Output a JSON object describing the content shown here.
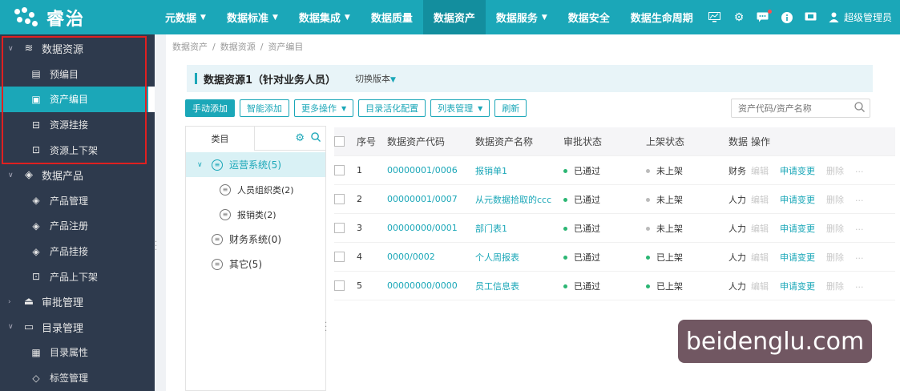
{
  "app": {
    "logo_text": "睿治"
  },
  "nav": [
    {
      "label": "元数据",
      "caret": true
    },
    {
      "label": "数据标准",
      "caret": true
    },
    {
      "label": "数据集成",
      "caret": true
    },
    {
      "label": "数据质量",
      "caret": false
    },
    {
      "label": "数据资产",
      "caret": false,
      "active": true
    },
    {
      "label": "数据服务",
      "caret": true
    },
    {
      "label": "数据安全",
      "caret": false
    },
    {
      "label": "数据生命周期",
      "caret": false
    }
  ],
  "user": {
    "name": "超级管理员"
  },
  "sidebar": {
    "groups": [
      {
        "label": "数据资源",
        "icon": "layers-icon",
        "expanded": true,
        "items": [
          {
            "label": "预编目",
            "icon": "list-icon"
          },
          {
            "label": "资产编目",
            "icon": "catalog-icon",
            "active": true
          },
          {
            "label": "资源挂接",
            "icon": "link-icon"
          },
          {
            "label": "资源上下架",
            "icon": "shelf-icon"
          }
        ]
      },
      {
        "label": "数据产品",
        "icon": "cube-icon",
        "expanded": true,
        "items": [
          {
            "label": "产品管理",
            "icon": "cube-gear-icon"
          },
          {
            "label": "产品注册",
            "icon": "cube-icon"
          },
          {
            "label": "产品挂接",
            "icon": "cube-link-icon"
          },
          {
            "label": "产品上下架",
            "icon": "shelf-icon"
          }
        ]
      },
      {
        "label": "审批管理",
        "icon": "stamp-icon",
        "expanded": false,
        "items": []
      },
      {
        "label": "目录管理",
        "icon": "folder-icon",
        "expanded": true,
        "items": [
          {
            "label": "目录属性",
            "icon": "grid-icon"
          },
          {
            "label": "标签管理",
            "icon": "tag-icon"
          }
        ]
      }
    ]
  },
  "breadcrumb": [
    "数据资产",
    "数据资源",
    "资产编目"
  ],
  "panel": {
    "title": "数据资源1（针对业务人员）",
    "switch_label": "切换版本"
  },
  "toolbar": {
    "add_manual": "手动添加",
    "add_smart": "智能添加",
    "more_ops": "更多操作",
    "catalog_config": "目录活化配置",
    "list_manage": "列表管理",
    "refresh": "刷新"
  },
  "search": {
    "placeholder": "资产代码/资产名称"
  },
  "tree": {
    "tab_label": "类目",
    "nodes": [
      {
        "label": "运营系统(5)",
        "level": 0,
        "selected": true,
        "expanded": true
      },
      {
        "label": "人员组织类(2)",
        "level": 1
      },
      {
        "label": "报销类(2)",
        "level": 1
      },
      {
        "label": "财务系统(0)",
        "level": 0
      },
      {
        "label": "其它(5)",
        "level": 0
      }
    ]
  },
  "table": {
    "headers": {
      "no": "序号",
      "code": "数据资产代码",
      "name": "数据资产名称",
      "audit": "审批状态",
      "shelf": "上架状态",
      "data": "数据",
      "ops": "操作"
    },
    "ops_labels": {
      "edit": "编辑",
      "change": "申请变更",
      "delete": "删除",
      "more": "..."
    },
    "rows": [
      {
        "no": "1",
        "code": "00000001/0006",
        "name": "报销单1",
        "audit": "已通过",
        "shelf": "未上架",
        "shelf_on": false,
        "data": "财务"
      },
      {
        "no": "2",
        "code": "00000001/0007",
        "name": "从元数据拾取的ccc",
        "audit": "已通过",
        "shelf": "未上架",
        "shelf_on": false,
        "data": "人力"
      },
      {
        "no": "3",
        "code": "00000000/0001",
        "name": "部门表1",
        "audit": "已通过",
        "shelf": "未上架",
        "shelf_on": false,
        "data": "人力"
      },
      {
        "no": "4",
        "code": "0000/0002",
        "name": "个人周报表",
        "audit": "已通过",
        "shelf": "已上架",
        "shelf_on": true,
        "data": "人力"
      },
      {
        "no": "5",
        "code": "00000000/0000",
        "name": "员工信息表",
        "audit": "已通过",
        "shelf": "已上架",
        "shelf_on": true,
        "data": "人力"
      }
    ]
  },
  "watermark": "beidenglu.com",
  "colors": {
    "brand": "#1ba7b8",
    "sidebar_bg": "#2e3a4d",
    "highlight_box": "#e02020"
  }
}
